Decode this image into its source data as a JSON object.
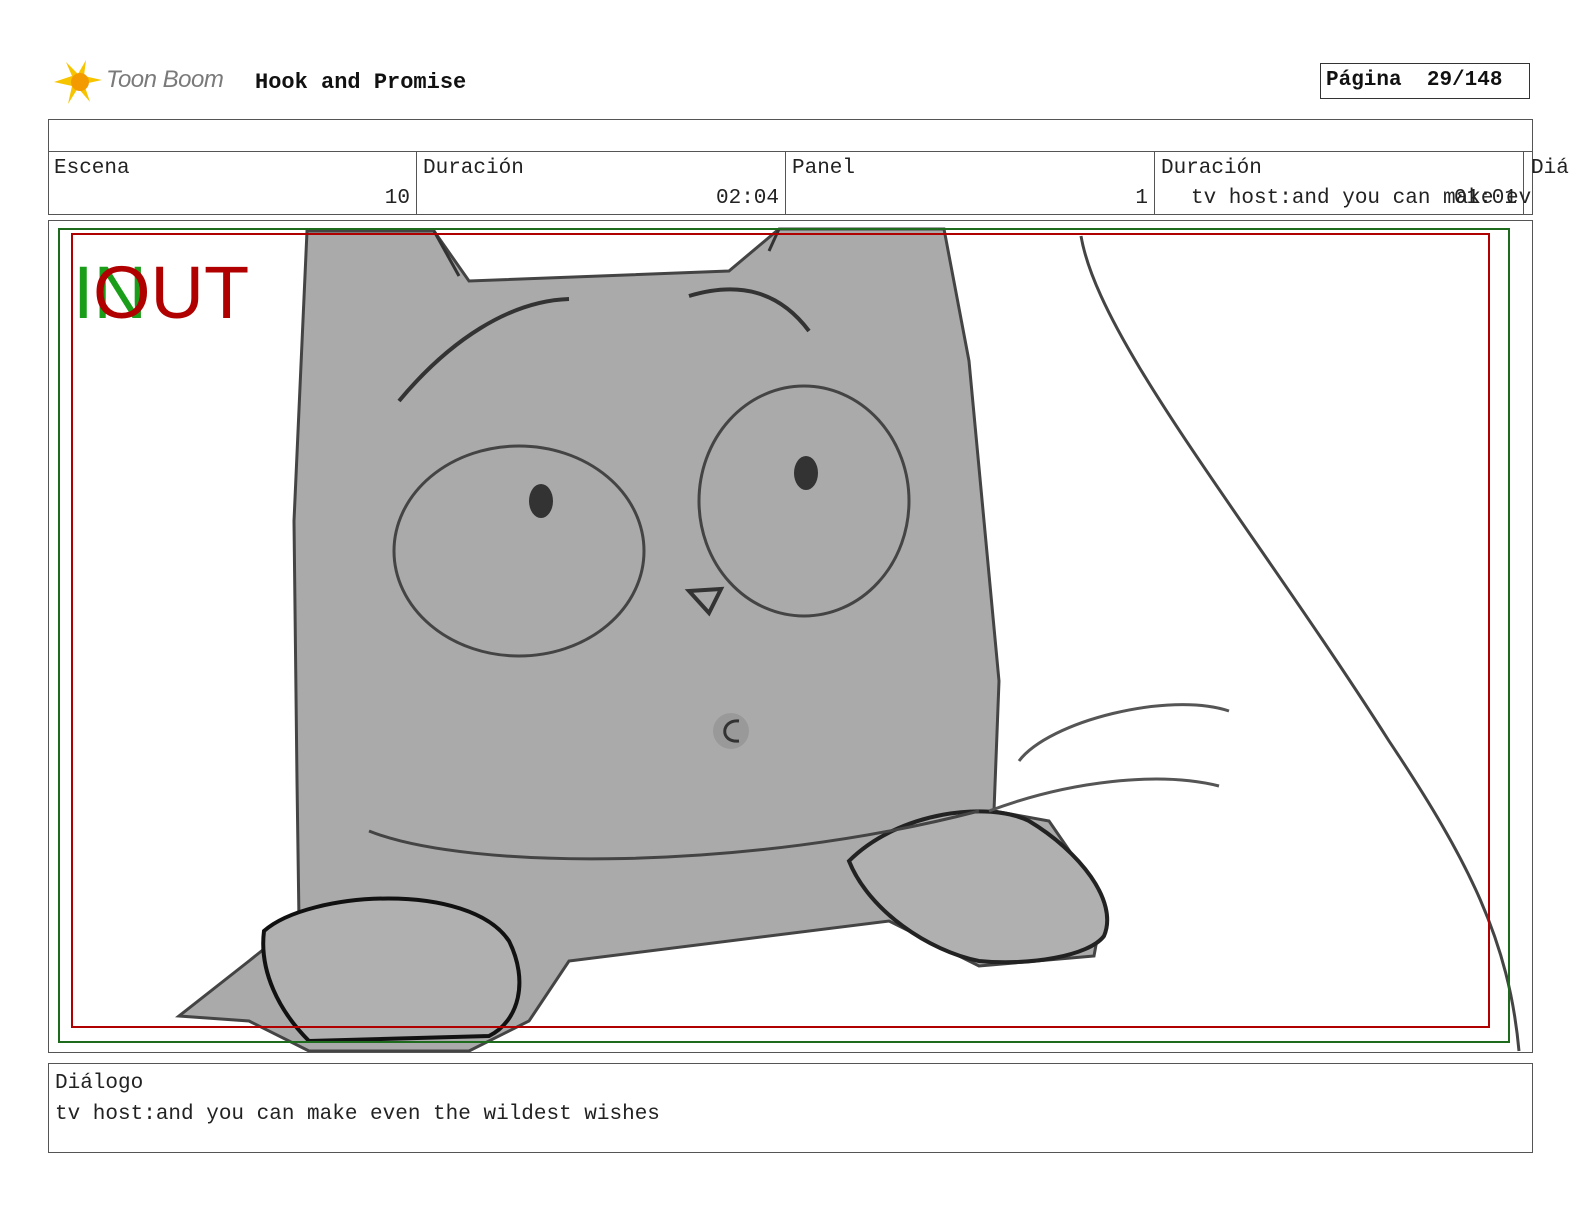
{
  "header": {
    "brand": "Toon Boom",
    "project_title": "Hook and Promise",
    "page_label": "Página",
    "page_value": "29/148"
  },
  "info": {
    "scene_label": "Escena",
    "scene_value": "10",
    "scene_duration_label": "Duración",
    "scene_duration_value": "02:04",
    "panel_label": "Panel",
    "panel_value": "1",
    "panel_duration_label": "Duración",
    "panel_duration_value": "01:01",
    "dialog_label_truncated": "Diá",
    "dialog_overflow_text": "tv host:and you can make ev"
  },
  "panel": {
    "in_marker": "IN",
    "out_marker": "OUT",
    "colors": {
      "in": "#1a9e1a",
      "out": "#b00000",
      "safe_frame": "#b00000",
      "camera_frame": "#1e6b1e",
      "character_fill": "#aaaaaa"
    }
  },
  "dialog": {
    "label": "Diálogo",
    "text": "tv host:and you can make even the wildest wishes"
  }
}
